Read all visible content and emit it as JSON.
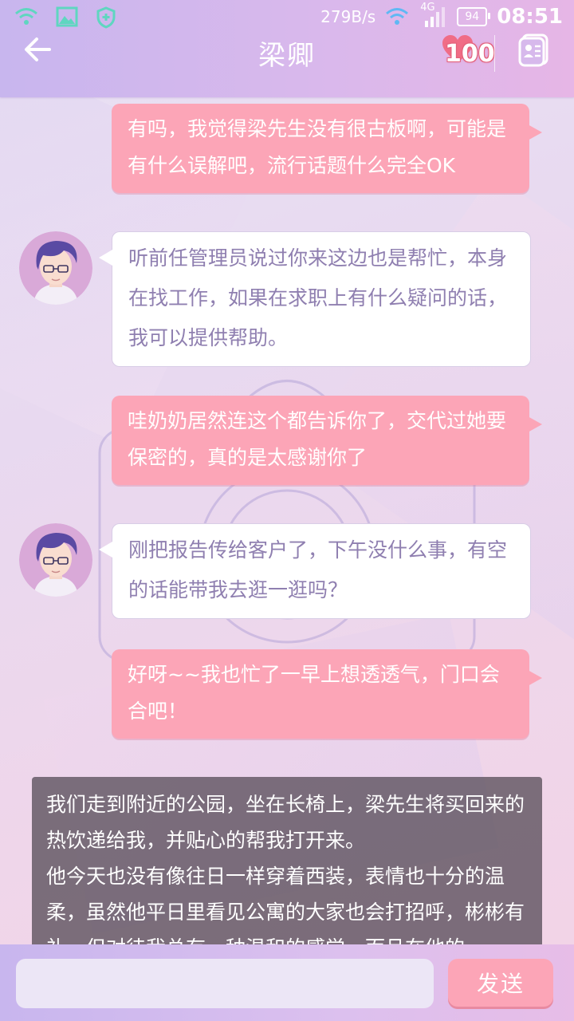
{
  "status_bar": {
    "net_speed": "279B/s",
    "network_type": "4G",
    "battery": "94",
    "time": "08:51",
    "icons": [
      "wifi-icon",
      "image-icon",
      "shield-icon",
      "wifi-icon",
      "cellular-signal-icon",
      "battery-icon"
    ]
  },
  "header": {
    "title": "梁卿",
    "favor_count": "100",
    "back_icon": "arrow-left-icon",
    "favor_icon": "heart-icon",
    "profile_icon": "contact-card-icon"
  },
  "messages": [
    {
      "from": "me",
      "text": "有吗，我觉得梁先生没有很古板啊，可能是有什么误解吧，流行话题什么完全OK"
    },
    {
      "from": "other",
      "text": "听前任管理员说过你来这边也是帮忙，本身在找工作，如果在求职上有什么疑问的话，我可以提供帮助。"
    },
    {
      "from": "me",
      "text": "哇奶奶居然连这个都告诉你了，交代过她要保密的，真的是太感谢你了"
    },
    {
      "from": "other",
      "text": "刚把报告传给客户了，下午没什么事，有空的话能带我去逛一逛吗？"
    },
    {
      "from": "me",
      "text": "好呀~~我也忙了一早上想透透气，门口会合吧！"
    }
  ],
  "narration": {
    "paragraph1": "我们走到附近的公园，坐在长椅上，梁先生将买回来的热饮递给我，并贴心的帮我打开来。",
    "paragraph2": "他今天也没有像往日一样穿着西装，表情也十分的温柔，虽然他平日里看见公寓的大家也会打招呼，彬彬有礼，但对待我总有一种温和的感觉，而且在他的"
  },
  "input_bar": {
    "input_value": "",
    "send_label": "发送"
  },
  "colors": {
    "my_bubble": "#fca5b7",
    "other_text": "#8f7fb0",
    "header": "#d2b7ee"
  }
}
